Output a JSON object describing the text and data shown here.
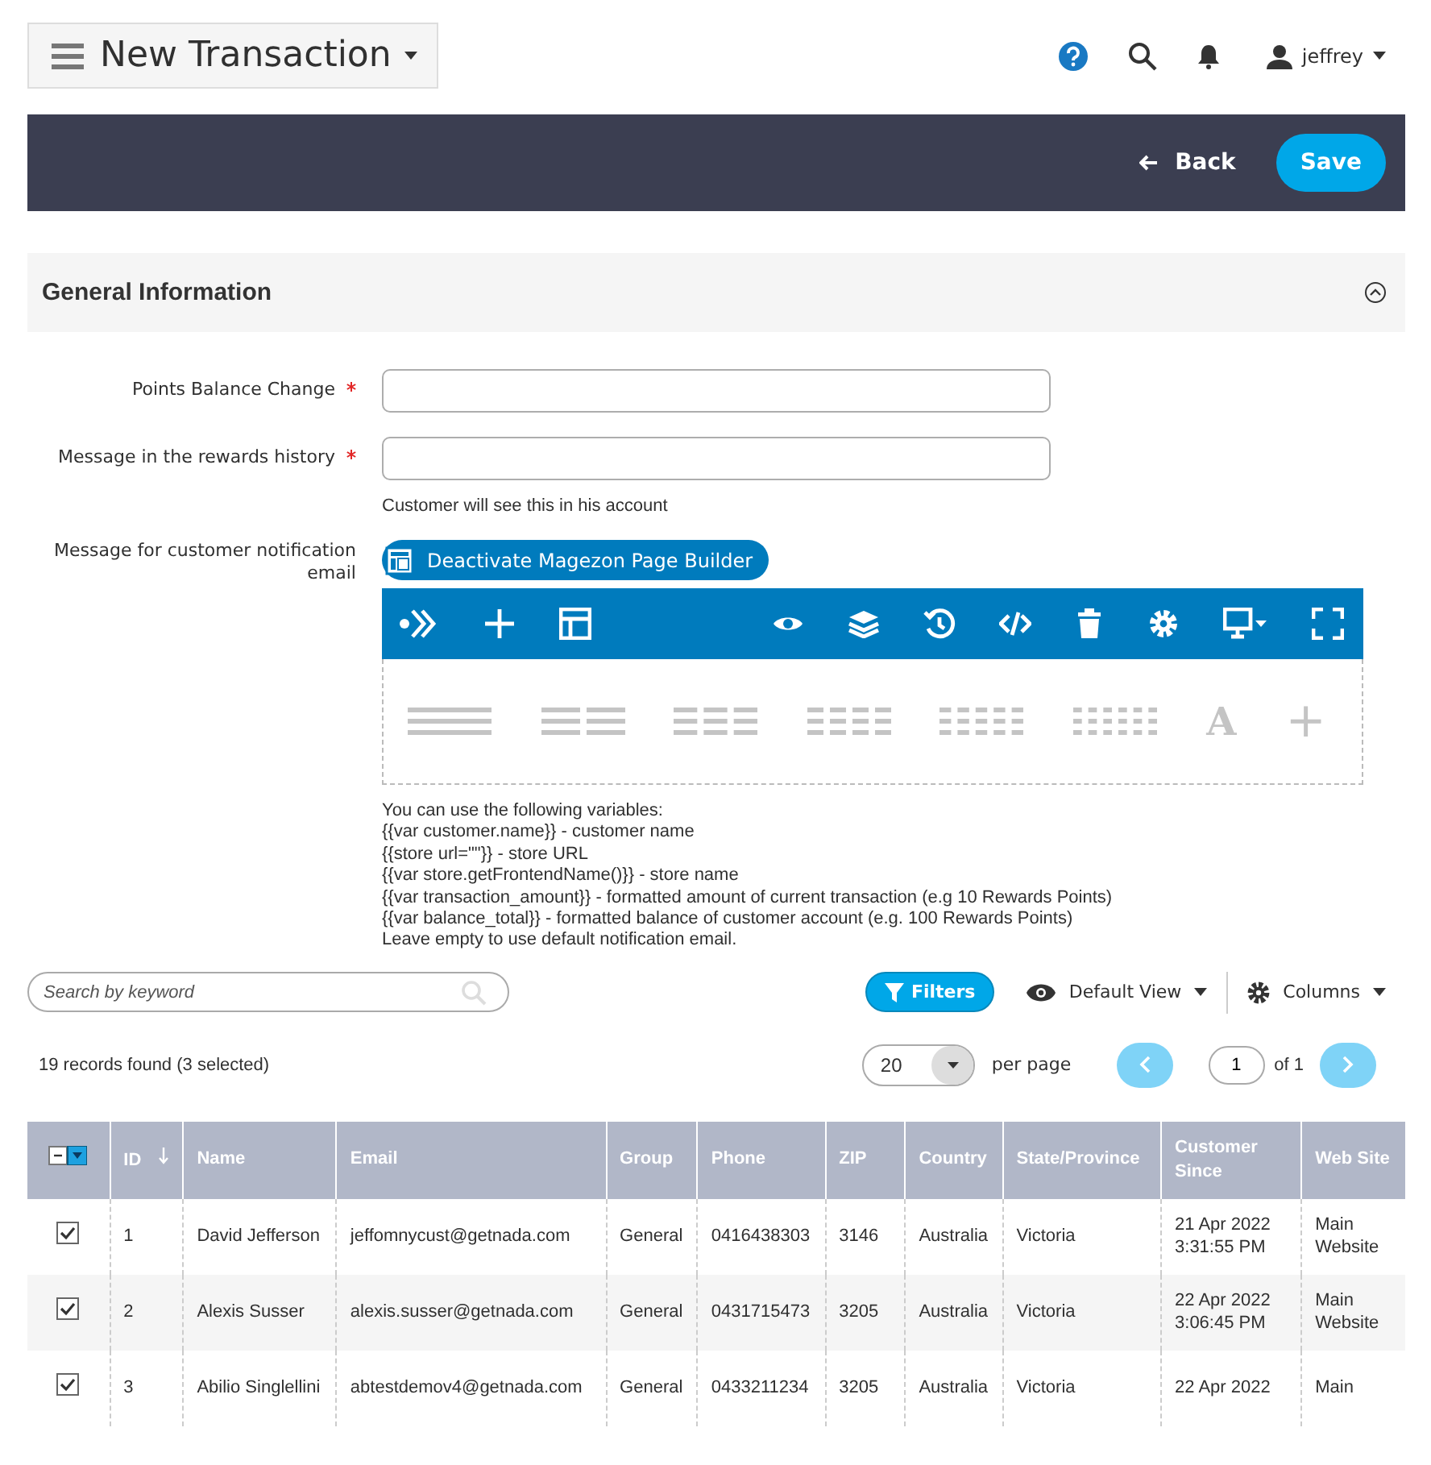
{
  "header": {
    "title": "New Transaction",
    "user": "jeffrey"
  },
  "action_bar": {
    "back": "Back",
    "save": "Save"
  },
  "section": {
    "title": "General Information",
    "expanded": true
  },
  "fields": [
    {
      "label": "Points Balance Change",
      "required": true
    },
    {
      "label": "Message in the rewards history",
      "required": true,
      "note": "Customer will see this in his account"
    }
  ],
  "editor": {
    "label": "Message for customer notification email",
    "toggle": "Deactivate Magezon Page Builder",
    "palette": [
      {
        "kind": "columns"
      },
      {
        "kind": "columns"
      },
      {
        "kind": "columns"
      },
      {
        "kind": "columns"
      },
      {
        "kind": "columns"
      },
      {
        "kind": "columns"
      },
      {
        "kind": "glyph",
        "glyph": "A"
      },
      {
        "kind": "glyph",
        "glyph": "+"
      }
    ],
    "help": [
      "You can use the following variables:",
      "{{var customer.name}} - customer name",
      "{{store url=\"\"}} - store URL",
      "{{var store.getFrontendName()}} - store name",
      "{{var transaction_amount}} - formatted amount of current transaction (e.g 10 Rewards Points)",
      "{{var balance_total}} - formatted balance of customer account (e.g. 100 Rewards Points)",
      "Leave empty to use default notification email."
    ]
  },
  "grid": {
    "search_placeholder": "Search by keyword",
    "filters": "Filters",
    "view": "Default View",
    "columns_button": "Columns",
    "records": "19 records found (3 selected)",
    "per_page_value": "20",
    "per_page": "per page",
    "page": "1",
    "of_pages": "of 1",
    "columns": [
      {
        "label": "ID",
        "sorted": true
      },
      {
        "label": "Name",
        "sorted": false
      },
      {
        "label": "Email",
        "sorted": false
      },
      {
        "label": "Group",
        "sorted": false
      },
      {
        "label": "Phone",
        "sorted": false
      },
      {
        "label": "ZIP",
        "sorted": false
      },
      {
        "label": "Country",
        "sorted": false
      },
      {
        "label": "State/Province",
        "sorted": false
      },
      {
        "label": "Customer Since",
        "sorted": false
      },
      {
        "label": "Web Site",
        "sorted": false
      }
    ],
    "rows": [
      {
        "checked": true,
        "cells": [
          "1",
          "David Jefferson",
          "jeffomnycust@getnada.com",
          "General",
          "0416438303",
          "3146",
          "Australia",
          "Victoria",
          "21 Apr 2022 3:31:55 PM",
          "Main Website"
        ]
      },
      {
        "checked": true,
        "cells": [
          "2",
          "Alexis Susser",
          "alexis.susser@getnada.com",
          "General",
          "0431715473",
          "3205",
          "Australia",
          "Victoria",
          "22 Apr 2022 3:06:45 PM",
          "Main Website"
        ]
      },
      {
        "checked": true,
        "cells": [
          "3",
          "Abilio Singlellini",
          "abtestdemov4@getnada.com",
          "General",
          "0433211234",
          "3205",
          "Australia",
          "Victoria",
          "22 Apr 2022",
          "Main"
        ]
      }
    ]
  }
}
